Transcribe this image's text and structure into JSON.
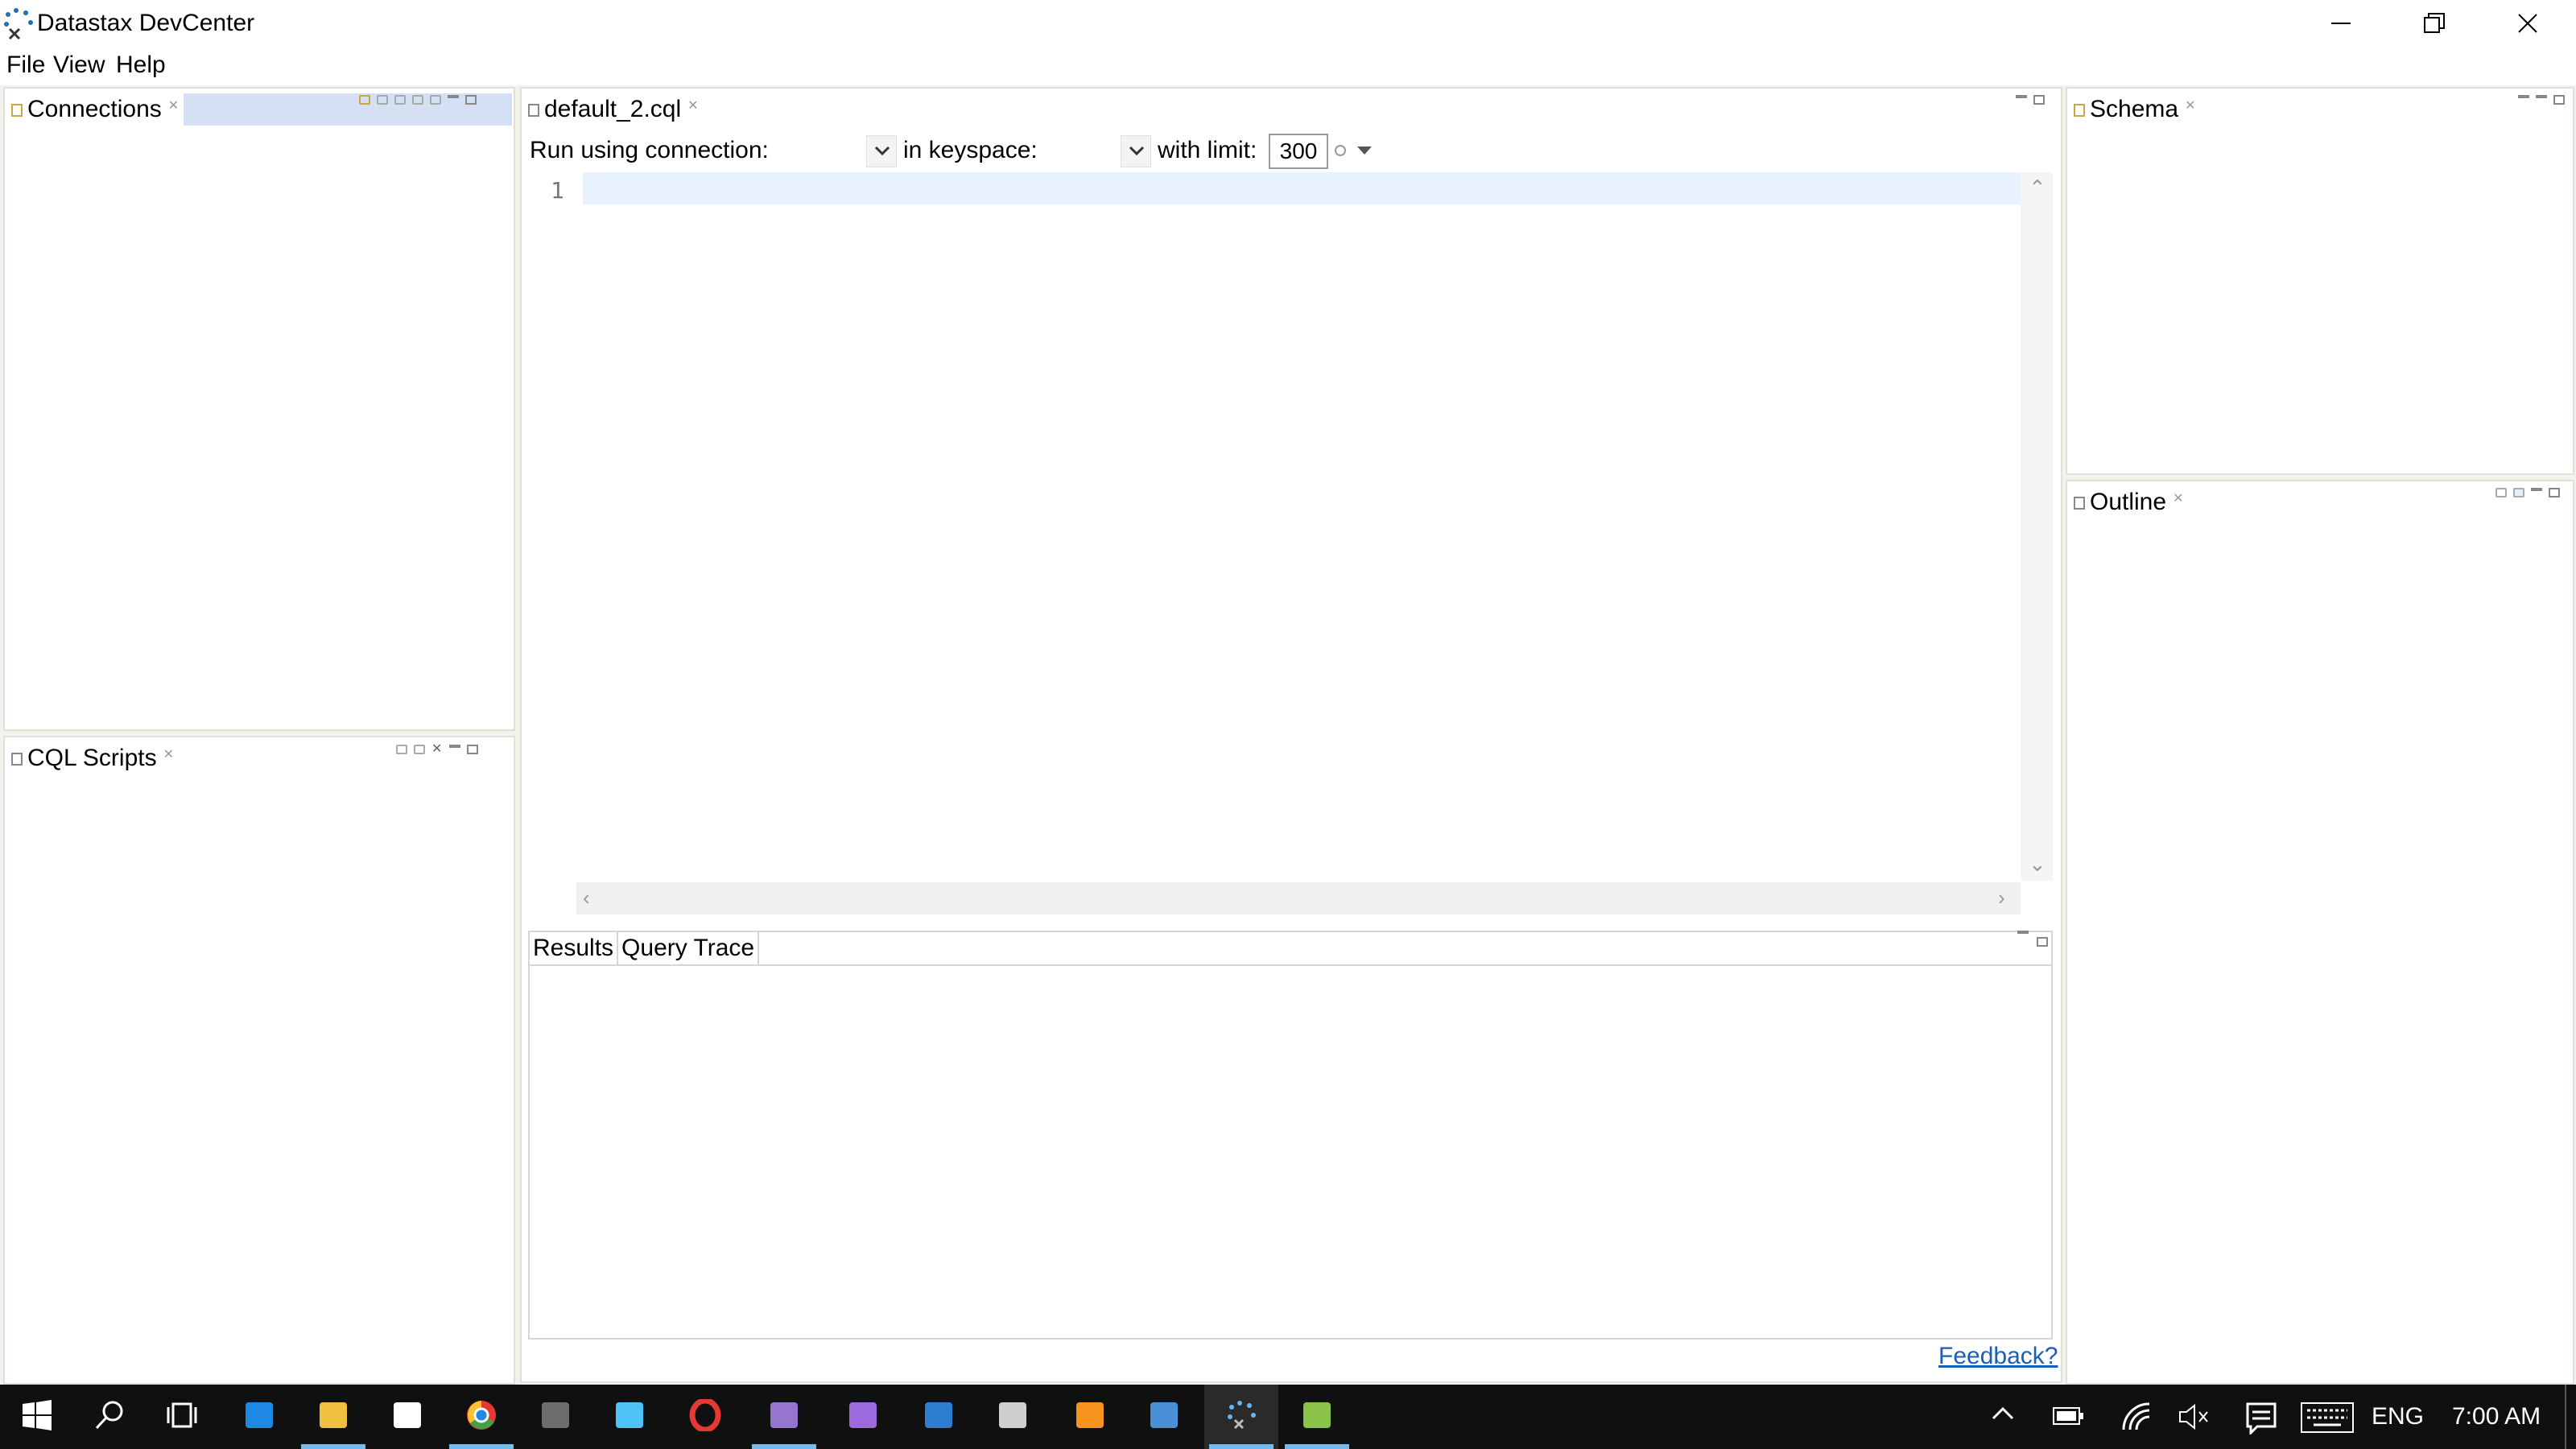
{
  "window": {
    "title": "Datastax DevCenter",
    "controls": [
      "minimize",
      "restore",
      "close"
    ]
  },
  "menubar": {
    "items": [
      "File",
      "View",
      "Help"
    ]
  },
  "panels": {
    "connections": {
      "title": "Connections"
    },
    "cql_scripts": {
      "title": "CQL Scripts"
    },
    "schema": {
      "title": "Schema"
    },
    "outline": {
      "title": "Outline"
    }
  },
  "editor": {
    "tab_title": "default_2.cql",
    "toolbar": {
      "connection_label": "Run using connection:",
      "keyspace_label": "in keyspace:",
      "limit_label": "with limit:",
      "limit_value": "300"
    },
    "line_numbers": [
      "1"
    ],
    "results": {
      "tabs": [
        "Results",
        "Query Trace"
      ]
    },
    "feedback_link": "Feedback?"
  },
  "taskbar": {
    "apps": [
      {
        "name": "start-button",
        "color": "#ffffff"
      },
      {
        "name": "search",
        "color": "#ffffff"
      },
      {
        "name": "task-view",
        "color": "#ffffff"
      },
      {
        "name": "edge",
        "color": "#1e88e5"
      },
      {
        "name": "file-explorer",
        "color": "#f0c040"
      },
      {
        "name": "store",
        "color": "#ffffff"
      },
      {
        "name": "chrome",
        "color": "#e53935"
      },
      {
        "name": "sublime",
        "color": "#6d6d6d"
      },
      {
        "name": "notes",
        "color": "#4fc3f7"
      },
      {
        "name": "opera",
        "color": "#e53935"
      },
      {
        "name": "paint",
        "color": "#9575cd"
      },
      {
        "name": "visual-studio",
        "color": "#9c6ade"
      },
      {
        "name": "powershell",
        "color": "#2d7dd2"
      },
      {
        "name": "command-prompt",
        "color": "#cfcfcf"
      },
      {
        "name": "matlab",
        "color": "#f7941d"
      },
      {
        "name": "intellij",
        "color": "#4a90d9"
      },
      {
        "name": "devcenter",
        "color": "#64b5f6"
      },
      {
        "name": "image-viewer",
        "color": "#8bc34a"
      }
    ],
    "tray": {
      "language": "ENG",
      "time": "7:00 AM"
    }
  }
}
